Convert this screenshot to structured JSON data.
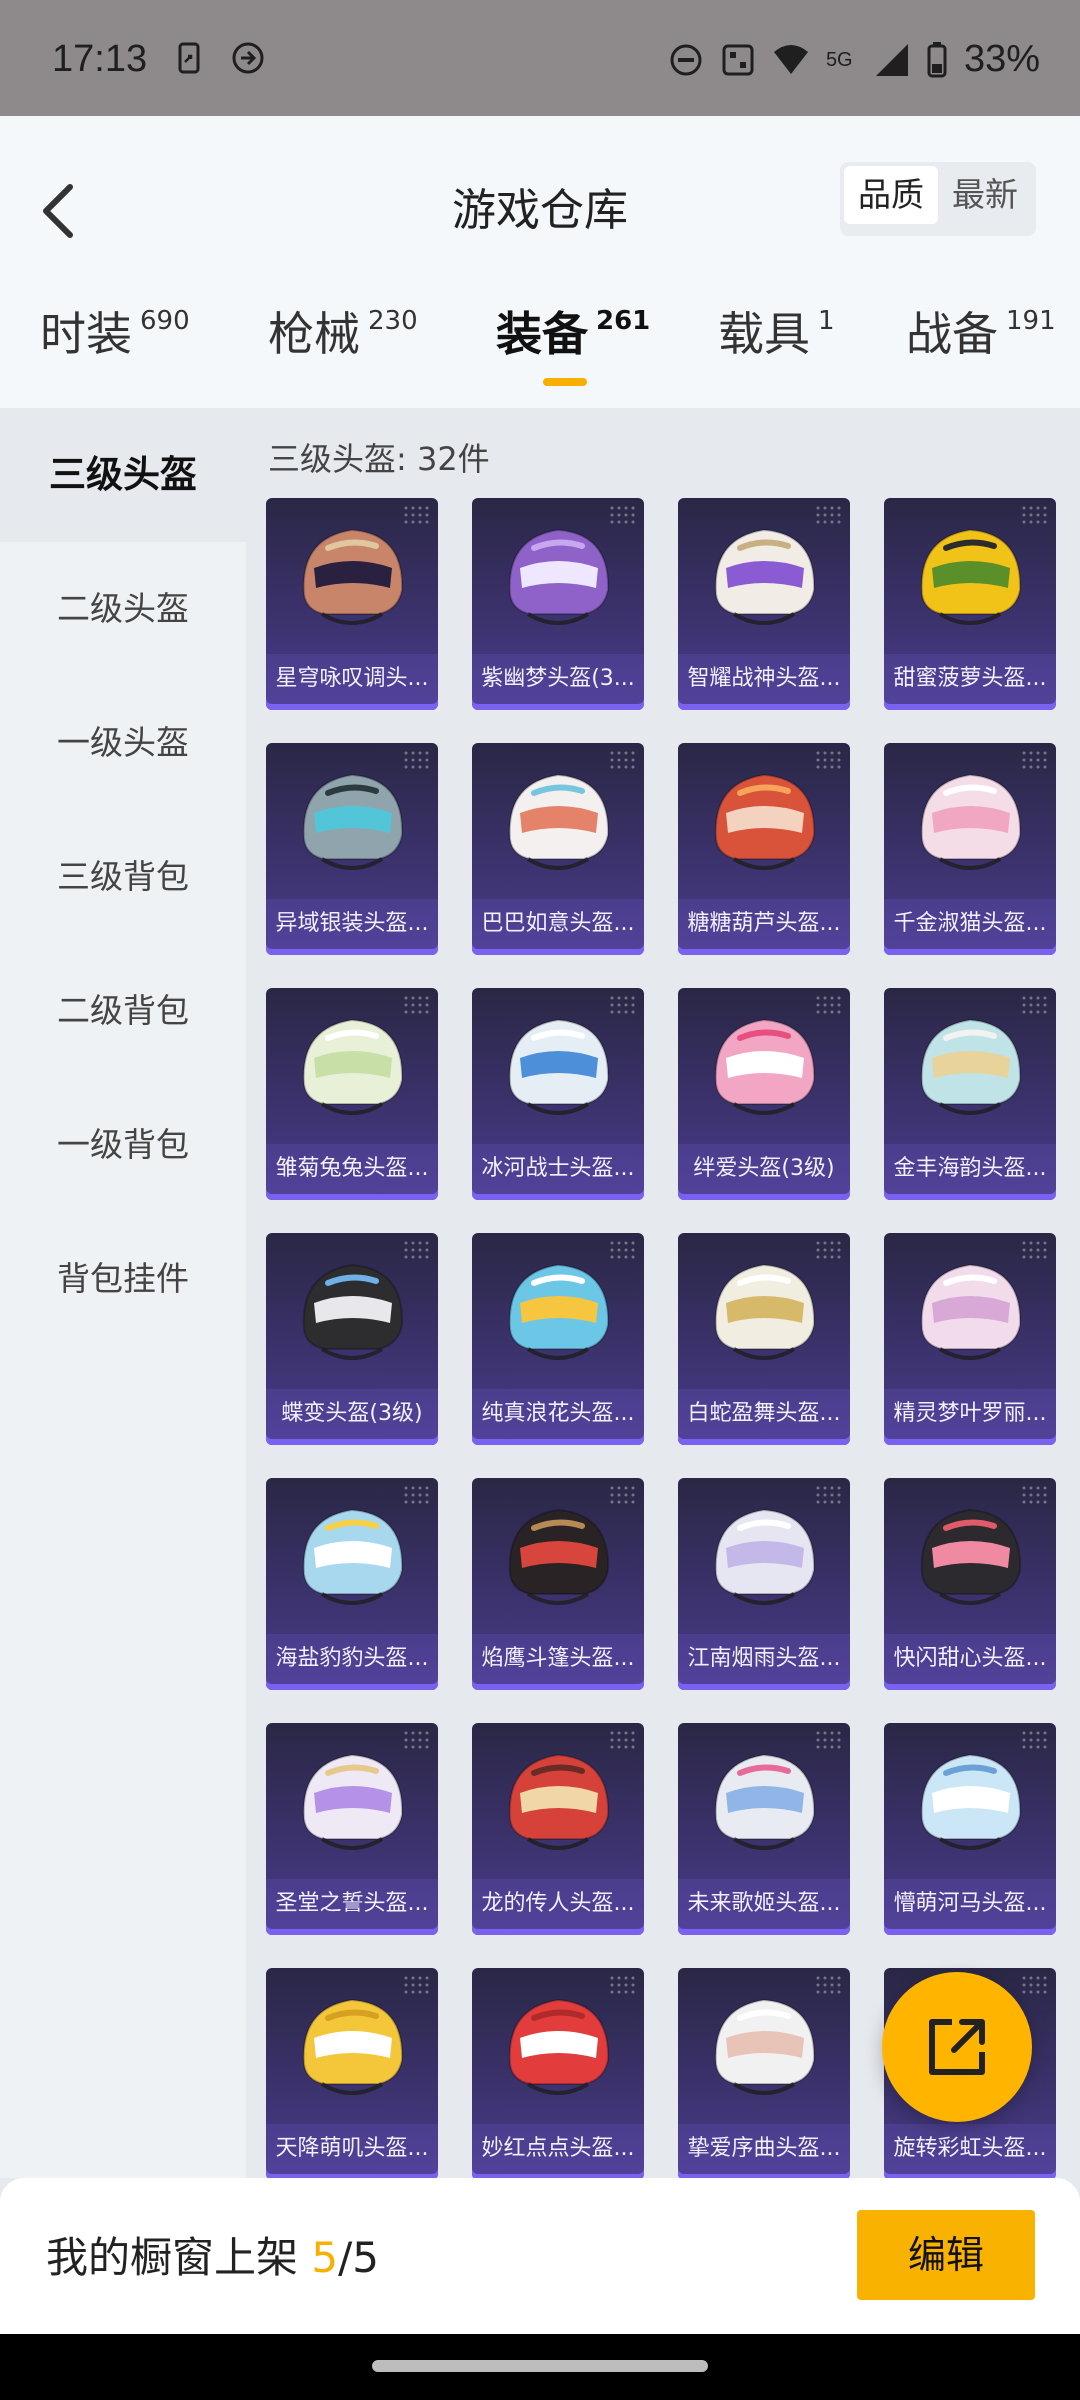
{
  "status_bar": {
    "time": "17:13",
    "network": "5G",
    "battery": "33%"
  },
  "header": {
    "title": "游戏仓库",
    "sort_options": [
      "品质",
      "最新"
    ],
    "tabs": [
      {
        "label": "时装",
        "count": "690"
      },
      {
        "label": "枪械",
        "count": "230"
      },
      {
        "label": "装备",
        "count": "261"
      },
      {
        "label": "载具",
        "count": "1"
      },
      {
        "label": "战备",
        "count": "191"
      }
    ]
  },
  "sidebar": {
    "items": [
      "三级头盔",
      "二级头盔",
      "一级头盔",
      "三级背包",
      "二级背包",
      "一级背包",
      "背包挂件"
    ]
  },
  "main": {
    "count_text": "三级头盔: 32件",
    "items": [
      {
        "name": "星穹咏叹调头...",
        "colors": [
          "#c9856a",
          "#2a2040",
          "#e0c7a0"
        ]
      },
      {
        "name": "紫幽梦头盔(3...",
        "colors": [
          "#8f62c9",
          "#efe6ff",
          "#c7a7ee"
        ]
      },
      {
        "name": "智耀战神头盔...",
        "colors": [
          "#f1ede6",
          "#8a5bd3",
          "#c9b083"
        ]
      },
      {
        "name": "甜蜜菠萝头盔...",
        "colors": [
          "#f1c319",
          "#5a8f2a",
          "#2c2c2c"
        ]
      },
      {
        "name": "异域银装头盔...",
        "colors": [
          "#8fa4ad",
          "#52c6d8",
          "#2d3a40"
        ]
      },
      {
        "name": "巴巴如意头盔...",
        "colors": [
          "#f4f0f0",
          "#e4826a",
          "#76c6de"
        ]
      },
      {
        "name": "糖糖葫芦头盔...",
        "colors": [
          "#d9533a",
          "#f3d3c0",
          "#f8a35a"
        ]
      },
      {
        "name": "千金淑猫头盔...",
        "colors": [
          "#f4dde6",
          "#f1a7c1",
          "#ffffff"
        ]
      },
      {
        "name": "雏菊兔兔头盔...",
        "colors": [
          "#e8f0d8",
          "#c8dfa8",
          "#ffffff"
        ]
      },
      {
        "name": "冰河战士头盔...",
        "colors": [
          "#e6eef5",
          "#4d8fd8",
          "#ffffff"
        ]
      },
      {
        "name": "绊爱头盔(3级)",
        "colors": [
          "#f3a6c3",
          "#ffffff",
          "#e84f7f"
        ]
      },
      {
        "name": "金丰海韵头盔...",
        "colors": [
          "#bfe3e6",
          "#e8d49a",
          "#f2f2f2"
        ]
      },
      {
        "name": "蝶变头盔(3级)",
        "colors": [
          "#2d2d2f",
          "#e8e8ec",
          "#6fb0e8"
        ]
      },
      {
        "name": "纯真浪花头盔...",
        "colors": [
          "#6cc7e6",
          "#f6c640",
          "#ffffff"
        ]
      },
      {
        "name": "白蛇盈舞头盔...",
        "colors": [
          "#f2ede1",
          "#d7b96a",
          "#ffffff"
        ]
      },
      {
        "name": "精灵梦叶罗丽...",
        "colors": [
          "#f2dcec",
          "#d8a9d6",
          "#ffffff"
        ]
      },
      {
        "name": "海盐豹豹头盔...",
        "colors": [
          "#a8d8ee",
          "#ffffff",
          "#f6d148"
        ]
      },
      {
        "name": "焰鹰斗篷头盔...",
        "colors": [
          "#2a2326",
          "#d8453c",
          "#b78a55"
        ]
      },
      {
        "name": "江南烟雨头盔...",
        "colors": [
          "#e6e6f2",
          "#c4b8e8",
          "#ffffff"
        ]
      },
      {
        "name": "快闪甜心头盔...",
        "colors": [
          "#2c2a2e",
          "#f08aa2",
          "#e05a6a"
        ]
      },
      {
        "name": "圣堂之誓头盔...",
        "colors": [
          "#efe9f6",
          "#b591e8",
          "#e7c98c"
        ]
      },
      {
        "name": "龙的传人头盔...",
        "colors": [
          "#d6423a",
          "#f1d6a8",
          "#6a2a28"
        ]
      },
      {
        "name": "未来歌姬头盔...",
        "colors": [
          "#e8ecf2",
          "#8fb6e6",
          "#e86a9a"
        ]
      },
      {
        "name": "懵萌河马头盔...",
        "colors": [
          "#cbe6f6",
          "#ffffff",
          "#6aa2d8"
        ]
      },
      {
        "name": "天降萌叽头盔...",
        "colors": [
          "#f4c63a",
          "#ffffff",
          "#d8a020"
        ]
      },
      {
        "name": "妙红点点头盔...",
        "colors": [
          "#e23c3c",
          "#ffffff",
          "#b02a2a"
        ]
      },
      {
        "name": "挚爱序曲头盔...",
        "colors": [
          "#f1f1f1",
          "#e8c4b8",
          "#ffffff"
        ]
      },
      {
        "name": "旋转彩虹头盔...",
        "colors": [
          "#f6c8d8",
          "#a6d8f2",
          "#ffffff"
        ]
      }
    ]
  },
  "bottom_bar": {
    "label": "我的橱窗上架 ",
    "current": "5",
    "total": "/5",
    "edit_label": "编辑"
  },
  "colors": {
    "accent": "#f7b000",
    "card_bg": "#3d3370"
  }
}
